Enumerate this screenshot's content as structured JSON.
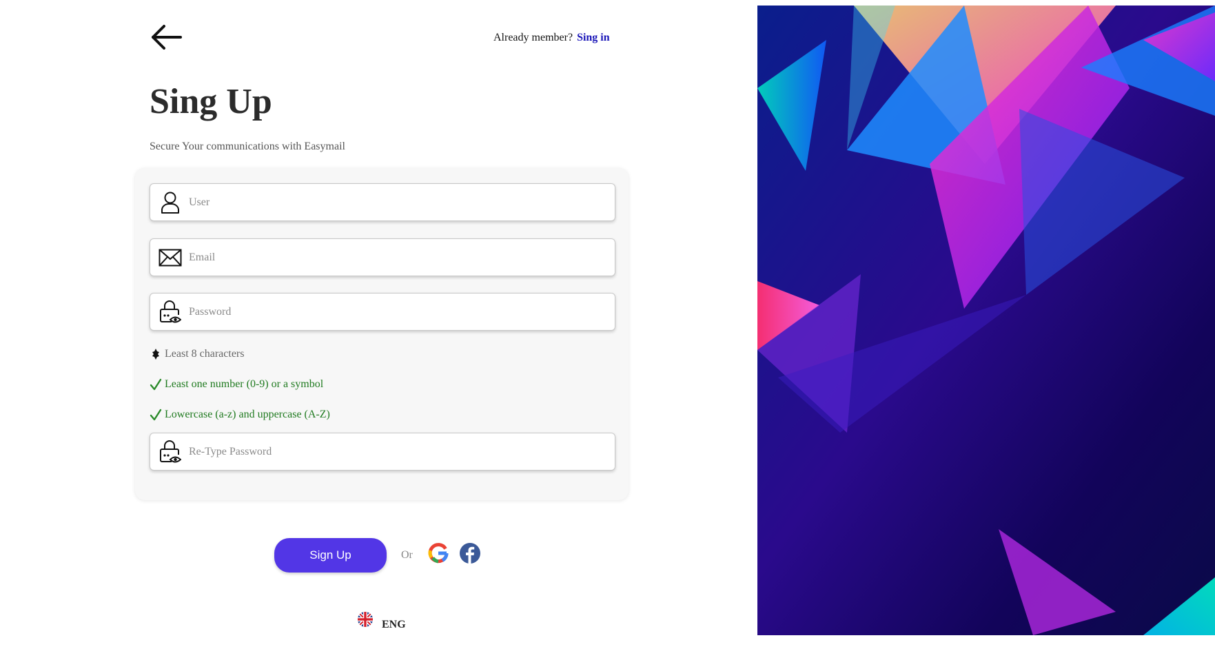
{
  "header": {
    "already_member": "Already member?",
    "signin_link": "Sing in"
  },
  "form": {
    "title": "Sing Up",
    "subtitle": "Secure Your communications with Easymail",
    "user_placeholder": "User",
    "email_placeholder": "Email",
    "password_placeholder": "Password",
    "retype_placeholder": "Re-Type Password",
    "rules": [
      {
        "text": "Least 8 characters",
        "status": "pending"
      },
      {
        "text": "Least one number (0-9) or a symbol",
        "status": "ok"
      },
      {
        "text": "Lowercase (a-z) and uppercase (A-Z)",
        "status": "ok"
      }
    ]
  },
  "actions": {
    "signup_label": "Sign Up",
    "or_label": "Or",
    "social": [
      "google-icon",
      "facebook-icon"
    ]
  },
  "language": {
    "code": "ENG",
    "flag": "uk-flag-icon"
  },
  "colors": {
    "accent": "#5236e6",
    "link": "#1a16b8",
    "success": "#1f7a1f"
  }
}
